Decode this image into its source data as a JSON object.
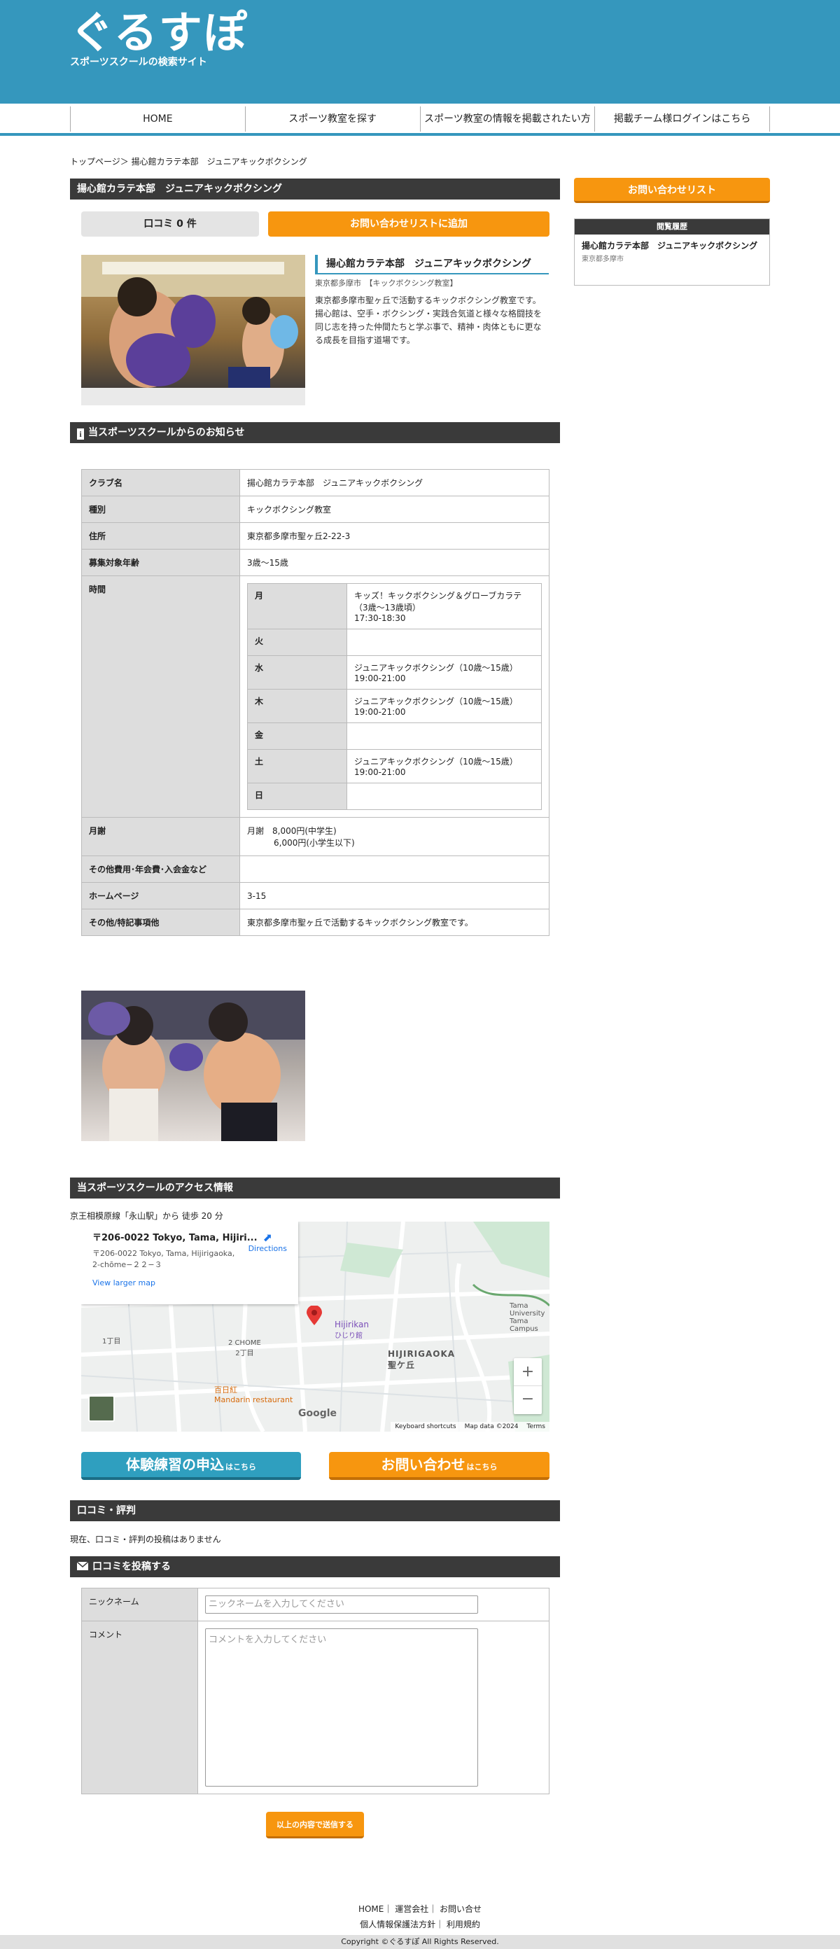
{
  "header": {
    "logo": "ぐるすぽ",
    "tagline": "スポーツスクールの検索サイト"
  },
  "nav": [
    "HOME",
    "スポーツ教室を探す",
    "スポーツ教室の情報を掲載されたい方",
    "掲載チーム様ログインはこちら"
  ],
  "breadcrumb": "トップページ＞ 揚心館カラテ本部　ジュニアキックボクシング",
  "school": {
    "name": "揚心館カラテ本部　ジュニアキックボクシング",
    "reviews_label": "口コミ 0 件",
    "add_list_button": "お問い合わせリストに追加",
    "meta": "東京都多摩市　【キックボクシング教室】",
    "description": "東京都多摩市聖ヶ丘で活動するキックボクシング教室です。揚心館は、空手・ボクシング・実践合気道と様々な格闘技を同じ志を持った仲間たちと学ぶ事で、精神・肉体ともに更なる成長を目指す道場です。"
  },
  "notice_heading": "当スポーツスクールからのお知らせ",
  "info": {
    "club_label": "クラブ名",
    "club_value": "揚心館カラテ本部　ジュニアキックボクシング",
    "type_label": "種別",
    "type_value": "キックボクシング教室",
    "address_label": "住所",
    "address_value": "東京都多摩市聖ヶ丘2-22-3",
    "age_label": "募集対象年齢",
    "age_value": "3歳〜15歳",
    "time_label": "時間",
    "schedule": [
      {
        "day": "月",
        "text": "キッズ！キックボクシング＆グローブカラテ（3歳〜13歳頃）",
        "time": "17:30-18:30"
      },
      {
        "day": "火",
        "text": "",
        "time": ""
      },
      {
        "day": "水",
        "text": "ジュニアキックボクシング（10歳〜15歳）",
        "time": "19:00-21:00"
      },
      {
        "day": "木",
        "text": "ジュニアキックボクシング（10歳〜15歳）",
        "time": "19:00-21:00"
      },
      {
        "day": "金",
        "text": "",
        "time": ""
      },
      {
        "day": "土",
        "text": "ジュニアキックボクシング（10歳〜15歳）",
        "time": "19:00-21:00"
      },
      {
        "day": "日",
        "text": "",
        "time": ""
      }
    ],
    "fee_label": "月謝",
    "fee_line1": "月謝　8,000円(中学生)",
    "fee_line2": "6,000円(小学生以下)",
    "other_fee_label": "その他費用･年会費･入会金など",
    "other_fee_value": "",
    "homepage_label": "ホームページ",
    "homepage_value": "3-15",
    "special_label": "その他/特記事項他",
    "special_value": "東京都多摩市聖ヶ丘で活動するキックボクシング教室です。"
  },
  "access": {
    "heading": "当スポーツスクールのアクセス情報",
    "route": "京王相模原線「永山駅」から 徒歩 20 分",
    "map_card_title": "〒206-0022 Tokyo, Tama, Hijiri...",
    "map_card_addr1": "〒206-0022 Tokyo, Tama, Hijirigaoka,",
    "map_card_addr2": "2-chōme−２２−３",
    "map_card_link": "View larger map",
    "directions": "Directions",
    "map_labels": [
      "Hijirikan",
      "ひじり館",
      "HIJIRIGAOKA",
      "聖ケ丘",
      "2 CHOME",
      "2丁目",
      "百日紅",
      "Mandarin restaurant",
      "Tama University",
      "Tama Campus",
      "1丁目"
    ],
    "google": "Google",
    "map_footer": [
      "Keyboard shortcuts",
      "Map data ©2024",
      "Terms"
    ]
  },
  "cta": {
    "trial_main": "体験練習の申込",
    "trial_sub": "はこちら",
    "contact_main": "お問い合わせ",
    "contact_sub": "はこちら"
  },
  "reviews": {
    "heading": "口コミ・評判",
    "empty": "現在、口コミ・評判の投稿はありません"
  },
  "post": {
    "heading": "口コミを投稿する",
    "nickname_label": "ニックネーム",
    "nickname_placeholder": "ニックネームを入力してください",
    "comment_label": "コメント",
    "comment_placeholder": "コメントを入力してください",
    "submit": "以上の内容で送信する"
  },
  "sidebar": {
    "contact_list_button": "お問い合わせリスト",
    "history_heading": "閲覧履歴",
    "history_name": "揚心館カラテ本部　ジュニアキックボクシング",
    "history_area": "東京都多摩市"
  },
  "footer": {
    "links1": [
      "HOME",
      "運営会社",
      "お問い合せ"
    ],
    "links2": [
      "個人情報保護法方針",
      "利用規約"
    ],
    "copyright": "Copyright ©ぐるすぽ All Rights Reserved."
  },
  "colors": {
    "brand": "#3597bd",
    "accent": "#f7960f",
    "bar": "#3a3a3a"
  }
}
